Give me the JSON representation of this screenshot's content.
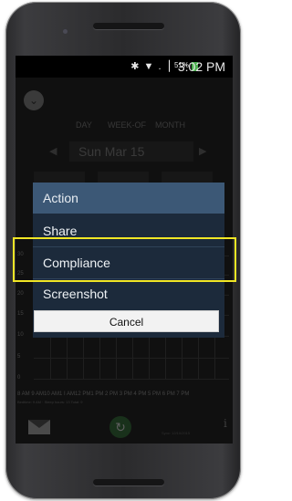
{
  "status_bar": {
    "time": "3:02 PM",
    "battery": "51%",
    "icons": "✱ ▼ .▕"
  },
  "tabs": {
    "day": "DAY",
    "week_of": "WEEK-OF",
    "month": "MONTH"
  },
  "date": {
    "current": "Sun Mar 15",
    "prev_arrow": "◀",
    "next_arrow": "▶"
  },
  "chart": {
    "y_ticks": [
      "30",
      "25",
      "20",
      "15",
      "10",
      "5",
      "0"
    ],
    "x_labels": "8 AM 9 AM10 AM1 I AM12 PM1 PM 2 PM 3 PM 4 PM 5 PM 6 PM 7 PM",
    "footnote": "Bedtime: 9 AM  ·  Sleep hours: 13  Total: 9"
  },
  "bottom": {
    "sync_text": "Sync: 12/10/2015",
    "info_icon": "i",
    "refresh_icon": "↻"
  },
  "dialog": {
    "title": "Action",
    "items": [
      "Share",
      "Compliance",
      "Screenshot"
    ],
    "cancel": "Cancel"
  },
  "chevron_icon": "⌄"
}
